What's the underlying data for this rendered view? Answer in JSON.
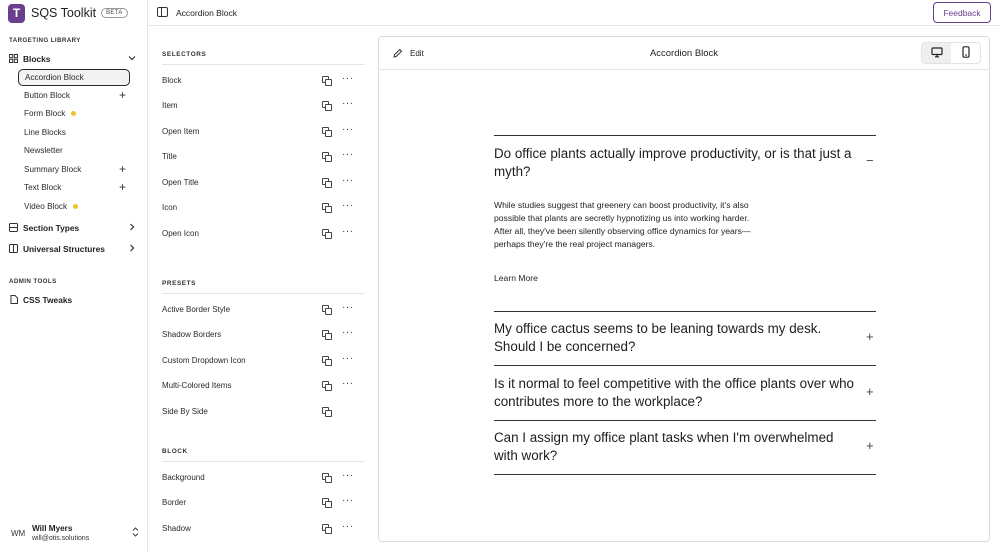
{
  "app": {
    "logo_letter": "T",
    "name": "SQS Toolkit",
    "badge": "BETA",
    "accent_color": "#6a3f8e",
    "status_dot_color": "#f2c12e"
  },
  "sidebar": {
    "targeting_label": "TARGETING LIBRARY",
    "blocks_label": "Blocks",
    "block_items": [
      {
        "label": "Accordion Block",
        "trailing": "none"
      },
      {
        "label": "Button Block",
        "trailing": "+"
      },
      {
        "label": "Form Block",
        "trailing": "dot"
      },
      {
        "label": "Line Blocks",
        "trailing": "none"
      },
      {
        "label": "Newsletter",
        "trailing": "none"
      },
      {
        "label": "Summary Block",
        "trailing": "+"
      },
      {
        "label": "Text Block",
        "trailing": "+"
      },
      {
        "label": "Video Block",
        "trailing": "dot"
      }
    ],
    "section_types_label": "Section Types",
    "universal_structures_label": "Universal Structures",
    "admin_label": "ADMIN TOOLS",
    "css_tweaks_label": "CSS Tweaks"
  },
  "user": {
    "initials": "WM",
    "name": "Will Myers",
    "email": "will@otis.solutions"
  },
  "header": {
    "title": "Accordion Block",
    "feedback_label": "Feedback"
  },
  "selectors": {
    "selectors_label": "SELECTORS",
    "selector_items": [
      "Block",
      "Item",
      "Open Item",
      "Title",
      "Open Title",
      "Icon",
      "Open Icon"
    ],
    "presets_label": "PRESETS",
    "preset_items": [
      "Active Border Style",
      "Shadow Borders",
      "Custom Dropdown Icon",
      "Multi-Colored Items",
      "Side By Side"
    ],
    "block_label": "BLOCK",
    "block_items": [
      "Background",
      "Border",
      "Shadow"
    ]
  },
  "preview": {
    "edit_label": "Edit",
    "title": "Accordion Block",
    "accordion": [
      {
        "question": "Do office plants actually improve productivity, or is that just a myth?",
        "answer": "While studies suggest that greenery can boost productivity, it's also possible that plants are secretly hypnotizing us into working harder. After all, they've been silently observing office dynamics for years—perhaps they're the real project managers.",
        "link": "Learn More",
        "icon": "−"
      },
      {
        "question": "My office cactus seems to be leaning towards my desk. Should I be concerned?",
        "icon": "+"
      },
      {
        "question": "Is it normal to feel competitive with the office plants over who contributes more to the workplace?",
        "icon": "+"
      },
      {
        "question": "Can I assign my office plant tasks when I'm overwhelmed with work?",
        "icon": "+"
      }
    ]
  }
}
